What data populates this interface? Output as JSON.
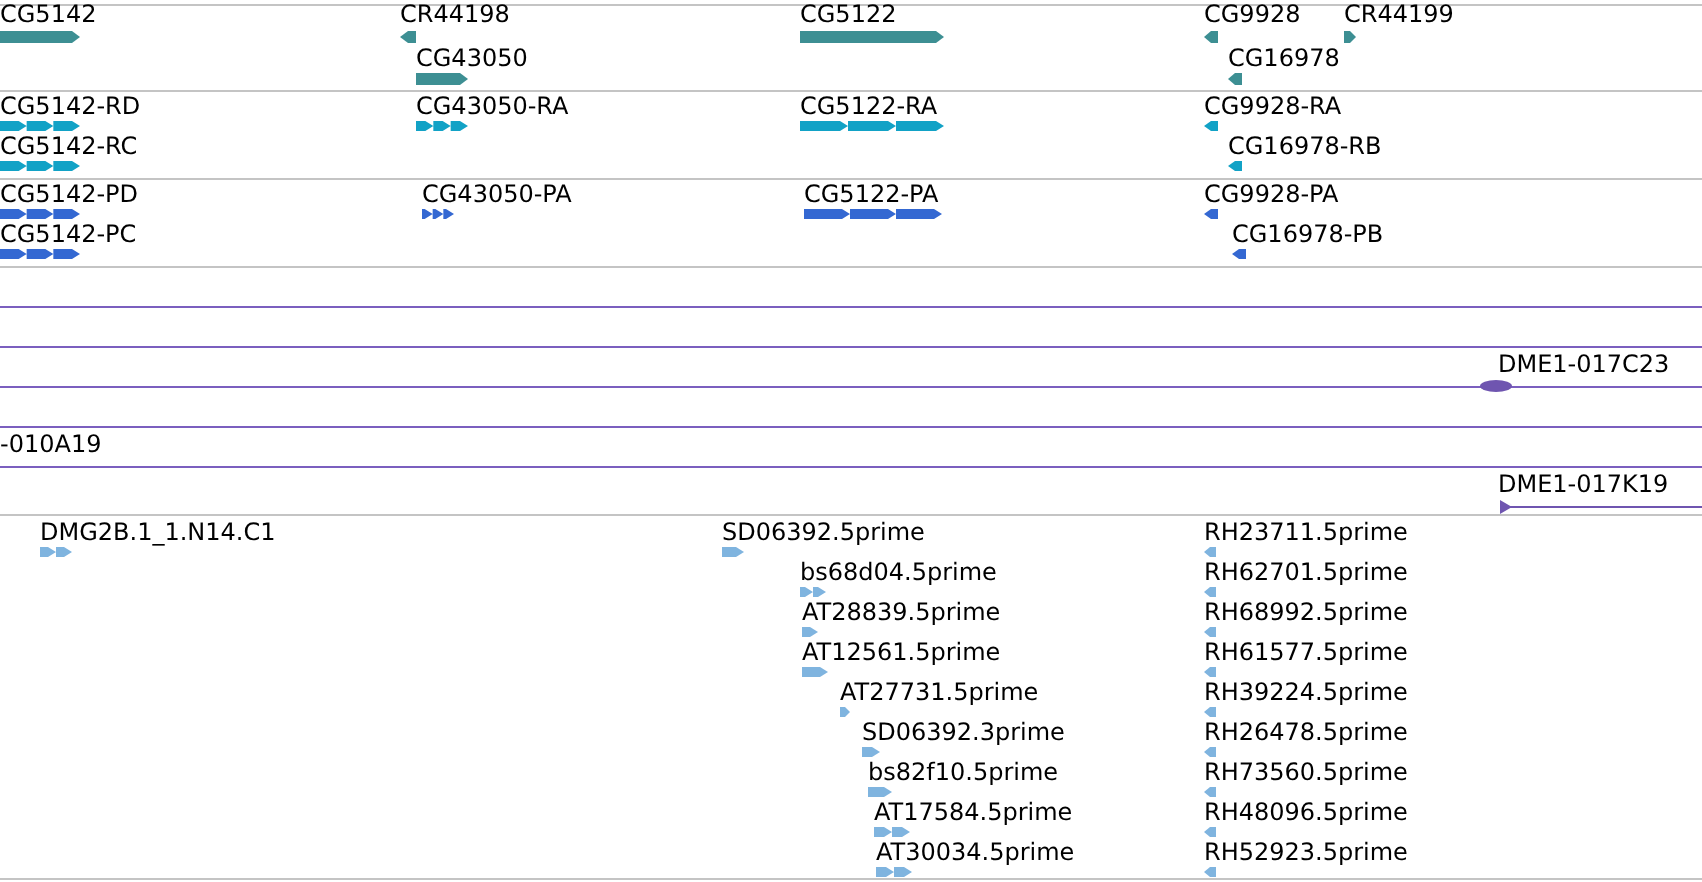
{
  "tracks": [
    {
      "kind": "gene",
      "features": [
        {
          "label": "CG5142",
          "reverse": false
        },
        {
          "label": "CR44198",
          "reverse": true
        },
        {
          "label": "CG43050",
          "reverse": false
        },
        {
          "label": "CG5122",
          "reverse": false
        },
        {
          "label": "CG9928",
          "reverse": true
        },
        {
          "label": "CR44199",
          "reverse": false
        },
        {
          "label": "CG16978",
          "reverse": true
        }
      ]
    },
    {
      "kind": "transcript",
      "features": [
        {
          "label": "CG5142-RD",
          "reverse": false
        },
        {
          "label": "CG5142-RC",
          "reverse": false
        },
        {
          "label": "CG43050-RA",
          "reverse": false
        },
        {
          "label": "CG5122-RA",
          "reverse": false
        },
        {
          "label": "CG9928-RA",
          "reverse": true
        },
        {
          "label": "CG16978-RB",
          "reverse": true
        }
      ]
    },
    {
      "kind": "protein",
      "features": [
        {
          "label": "CG5142-PD",
          "reverse": false
        },
        {
          "label": "CG5142-PC",
          "reverse": false
        },
        {
          "label": "CG43050-PA",
          "reverse": false
        },
        {
          "label": "CG5122-PA",
          "reverse": false
        },
        {
          "label": "CG9928-PA",
          "reverse": true
        },
        {
          "label": "CG16978-PB",
          "reverse": true
        }
      ]
    },
    {
      "kind": "clone",
      "features": [
        {
          "label": "DME1-017C23"
        },
        {
          "label": "-010A19"
        },
        {
          "label": "DME1-017K19",
          "reverse": false
        }
      ]
    },
    {
      "kind": "est",
      "features": [
        {
          "label": "DMG2B.1_1.N14.C1",
          "reverse": false
        },
        {
          "label": "SD06392.5prime",
          "reverse": false
        },
        {
          "label": "bs68d04.5prime",
          "reverse": false
        },
        {
          "label": "AT28839.5prime",
          "reverse": false
        },
        {
          "label": "AT12561.5prime",
          "reverse": false
        },
        {
          "label": "AT27731.5prime",
          "reverse": false
        },
        {
          "label": "SD06392.3prime",
          "reverse": false
        },
        {
          "label": "bs82f10.5prime",
          "reverse": false
        },
        {
          "label": "AT17584.5prime",
          "reverse": false
        },
        {
          "label": "AT30034.5prime",
          "reverse": false
        },
        {
          "label": "RH23711.5prime",
          "reverse": true
        },
        {
          "label": "RH62701.5prime",
          "reverse": true
        },
        {
          "label": "RH68992.5prime",
          "reverse": true
        },
        {
          "label": "RH61577.5prime",
          "reverse": true
        },
        {
          "label": "RH39224.5prime",
          "reverse": true
        },
        {
          "label": "RH26478.5prime",
          "reverse": true
        },
        {
          "label": "RH73560.5prime",
          "reverse": true
        },
        {
          "label": "RH48096.5prime",
          "reverse": true
        },
        {
          "label": "RH52923.5prime",
          "reverse": true
        }
      ]
    }
  ]
}
